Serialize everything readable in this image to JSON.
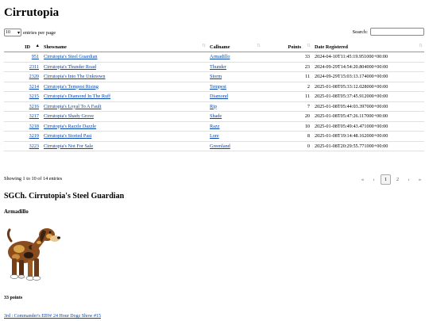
{
  "title": "Cirrutopia",
  "length_menu": {
    "selected": "10",
    "suffix": "entries per page"
  },
  "search": {
    "label": "Search:",
    "value": ""
  },
  "columns": {
    "id": "ID",
    "showname": "Showname",
    "callname": "Callname",
    "points": "Points",
    "date": "Date Registered"
  },
  "rows": [
    {
      "id": "951",
      "showname": "Cirrutopia's Steel Guardian",
      "callname": "Armadillo",
      "points": "33",
      "date": "2024-04-10T11:45:19.951000+00:00"
    },
    {
      "id": "2311",
      "showname": "Cirrutopia's Thunder Road",
      "callname": "Thunder",
      "points": "23",
      "date": "2024-09-29T14:54:20.804000+00:00"
    },
    {
      "id": "2320",
      "showname": "Cirrutopia's Into The Unknown",
      "callname": "Storm",
      "points": "11",
      "date": "2024-09-29T15:03:13.174000+00:00"
    },
    {
      "id": "3214",
      "showname": "Cirrutopia's Tempest Rising",
      "callname": "Tempest",
      "points": "2",
      "date": "2025-01-08T05:33:12.028000+00:00"
    },
    {
      "id": "3215",
      "showname": "Cirrutopia's Diamond In The Ruff",
      "callname": "Diamond",
      "points": "11",
      "date": "2025-01-08T05:37:45.912000+00:00"
    },
    {
      "id": "3216",
      "showname": "Cirrutopia's Loyal To A Fault",
      "callname": "Rip",
      "points": "7",
      "date": "2025-01-08T05:44:03.397000+00:00"
    },
    {
      "id": "3217",
      "showname": "Cirrutopia's Shady Grove",
      "callname": "Shade",
      "points": "20",
      "date": "2025-01-08T05:47:26.117000+00:00"
    },
    {
      "id": "3218",
      "showname": "Cirrutopia's Razzle Dazzle",
      "callname": "Razz",
      "points": "10",
      "date": "2025-01-08T05:49:43.471000+00:00"
    },
    {
      "id": "3219",
      "showname": "Cirrutopia's Storied Past",
      "callname": "Lore",
      "points": "8",
      "date": "2025-01-08T19:14:48.162000+00:00"
    },
    {
      "id": "3223",
      "showname": "Cirrutopia's Not For Sale",
      "callname": "Greenland",
      "points": "0",
      "date": "2025-01-08T20:29:55.771000+00:00"
    }
  ],
  "info": "Showing 1 to 10 of 14 entries",
  "pager": {
    "first": "«",
    "prev": "‹",
    "pages": [
      "1",
      "2"
    ],
    "current": "1",
    "next": "›",
    "last": "»"
  },
  "detail": {
    "heading": "SGCh. Cirrutopia's Steel Guardian",
    "callname": "Armadillo",
    "points": "33 points",
    "award": "3rd : Commander's EBW 24 Hour Dogz Show #15",
    "image_icon": "dog-image"
  }
}
